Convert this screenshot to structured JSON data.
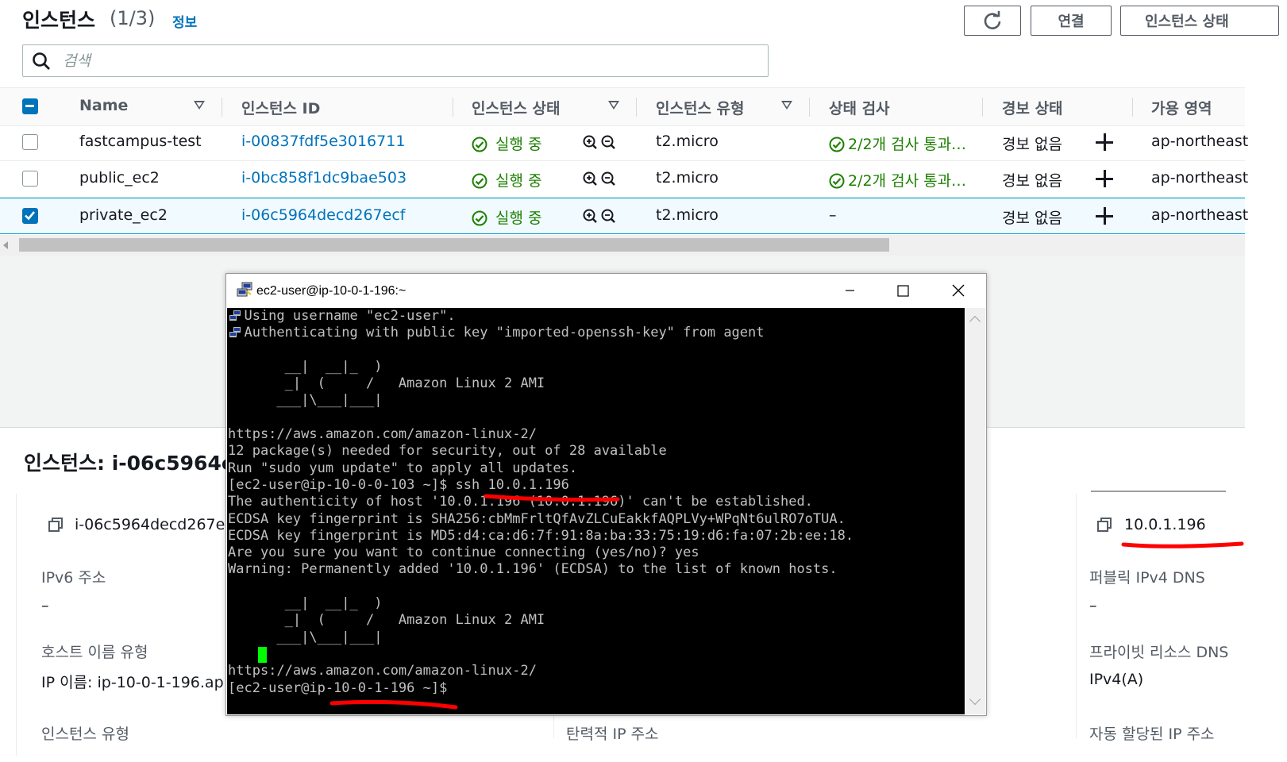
{
  "header": {
    "title": "인스턴스",
    "count": "(1/3)",
    "info": "정보",
    "connect_label": "연결",
    "state_label": "인스턴스 상태"
  },
  "search": {
    "placeholder": "검색",
    "value": ""
  },
  "table": {
    "columns": [
      "Name",
      "인스턴스 ID",
      "인스턴스 상태",
      "인스턴스 유형",
      "상태 검사",
      "경보 상태",
      "가용 영역"
    ],
    "rows": [
      {
        "selected": false,
        "name": "fastcampus-test",
        "id": "i-00837fdf5e3016711",
        "state": "실행 중",
        "type": "t2.micro",
        "check": "2/2개 검사 통과…",
        "alarm": "경보 없음",
        "az": "ap-northeast"
      },
      {
        "selected": false,
        "name": "public_ec2",
        "id": "i-0bc858f1dc9bae503",
        "state": "실행 중",
        "type": "t2.micro",
        "check": "2/2개 검사 통과…",
        "alarm": "경보 없음",
        "az": "ap-northeast"
      },
      {
        "selected": true,
        "name": "private_ec2",
        "id": "i-06c5964decd267ecf",
        "state": "실행 중",
        "type": "t2.micro",
        "check": "–",
        "alarm": "경보 없음",
        "az": "ap-northeast"
      }
    ]
  },
  "details": {
    "title": "인스턴스: i-06c5964c",
    "instance_id_value": "i-06c5964decd267ec",
    "ipv6_label": "IPv6 주소",
    "ipv6_value": "–",
    "hostname_type_label": "호스트 이름 유형",
    "hostname_type_value": "IP 이름: ip-10-0-1-196.ap",
    "instance_type_label": "인스턴스 유형",
    "elastic_ip_label": "탄력적 IP 주소",
    "private_ip_value": "10.0.1.196",
    "public_dns_label": "퍼블릭 IPv4 DNS",
    "public_dns_value": "–",
    "private_dns_label": "프라이빗 리소스 DNS",
    "private_dns_value": "IPv4(A)",
    "auto_ip_label": "자동 할당된 IP 주소"
  },
  "terminal": {
    "window_title": "ec2-user@ip-10-0-1-196:~",
    "lines": [
      "  Using username \"ec2-user\".",
      "  Authenticating with public key \"imported-openssh-key\" from agent",
      "",
      "       __|  __|_  )",
      "       _|  (     /   Amazon Linux 2 AMI",
      "      ___|\\___|___|",
      "",
      "https://aws.amazon.com/amazon-linux-2/",
      "12 package(s) needed for security, out of 28 available",
      "Run \"sudo yum update\" to apply all updates.",
      "[ec2-user@ip-10-0-0-103 ~]$ ssh 10.0.1.196",
      "The authenticity of host '10.0.1.196 (10.0.1.196)' can't be established.",
      "ECDSA key fingerprint is SHA256:cbMmFrltQfAvZLCuEakkfAQPLVy+WPqNt6ulRO7oTUA.",
      "ECDSA key fingerprint is MD5:d4:ca:d6:7f:91:8a:ba:33:75:19:d6:fa:07:2b:ee:18.",
      "Are you sure you want to continue connecting (yes/no)? yes",
      "Warning: Permanently added '10.0.1.196' (ECDSA) to the list of known hosts.",
      "",
      "       __|  __|_  )",
      "       _|  (     /   Amazon Linux 2 AMI",
      "      ___|\\___|___|",
      "",
      "https://aws.amazon.com/amazon-linux-2/",
      "[ec2-user@ip-10-0-1-196 ~]$ "
    ]
  },
  "colors": {
    "link": "#0073bb",
    "running": "#1d8102",
    "annotation": "#ff0000",
    "cursor": "#00ff00"
  }
}
